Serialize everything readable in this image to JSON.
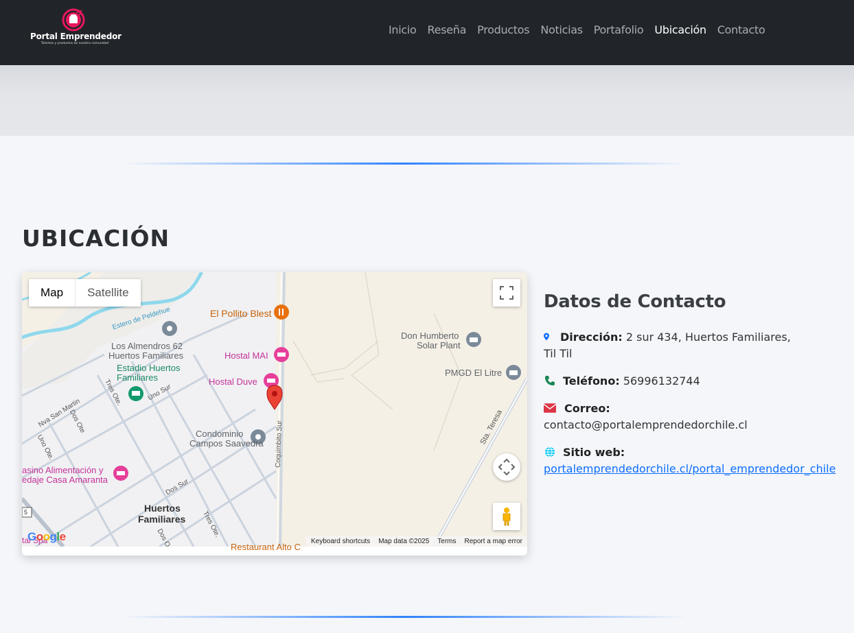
{
  "navbar": {
    "logo_title": "Portal Emprendedor",
    "logo_subtitle": "Talentos y productos de nuestra comunidad",
    "items": [
      {
        "label": "Inicio"
      },
      {
        "label": "Reseña"
      },
      {
        "label": "Productos"
      },
      {
        "label": "Noticias"
      },
      {
        "label": "Portafolio"
      },
      {
        "label": "Ubicación",
        "active": true
      },
      {
        "label": "Contacto"
      }
    ]
  },
  "section": {
    "title": "UBICACIÓN"
  },
  "map": {
    "type_map": "Map",
    "type_satellite": "Satellite",
    "labels": {
      "estero": "Estero de Peldehue",
      "pollito": "El Pollito Blest",
      "don_humberto_1": "Don Humberto",
      "don_humberto_2": "Solar Plant",
      "almendros_1": "Los Almendros 62",
      "almendros_2": "Huertos Familiares",
      "hostal_mai": "Hostal MAI",
      "estadio_1": "Estadio Huertos",
      "estadio_2": "Familiares",
      "hostal_duve": "Hostal Duve",
      "pmgd": "PMGD El Litre",
      "tres_ote": "Tres Ote.",
      "uno_sur": "Uno Sur",
      "nva_san_martin": "Nva San Martin",
      "dos_ote": "Dos Ote",
      "uno_ote": "Uno Ote.",
      "condominio_1": "Condominio",
      "condominio_2": "Campos Saavedra",
      "coquimbito": "Coquimbito Sur",
      "sta_teresa": "Sta. Teresa",
      "casino_1": "asino Alimentación y",
      "casino_2": "edaje Casa Amaranta",
      "dos_sur": "Dos Sur",
      "huertos_1": "Huertos",
      "huertos_2": "Familiares",
      "tres_ote_2": "Tres Ote.",
      "dos_o": "Dos O",
      "restaurant": "Restaurant Alto C",
      "tal_spa": "tal Spa",
      "route": "5"
    },
    "google": "Google",
    "footer": {
      "shortcuts": "Keyboard shortcuts",
      "data": "Map data ©2025",
      "terms": "Terms",
      "report": "Report a map error"
    }
  },
  "contact": {
    "title": "Datos de Contacto",
    "address_label": "Dirección:",
    "address_value": "2 sur 434, Huertos Familiares,",
    "address_value_2": "Til Til",
    "phone_label": "Teléfono:",
    "phone_value": "56996132744",
    "email_label": "Correo:",
    "email_value": "contacto@portalemprendedorchile.cl",
    "web_label": "Sitio web:",
    "web_value": "portalemprendedorchile.cl/portal_emprendedor_chile"
  },
  "colors": {
    "navbar_bg": "#212529",
    "accent": "#0d6efd",
    "logo_pink": "#e8175d",
    "pin_red": "#ea4335"
  }
}
